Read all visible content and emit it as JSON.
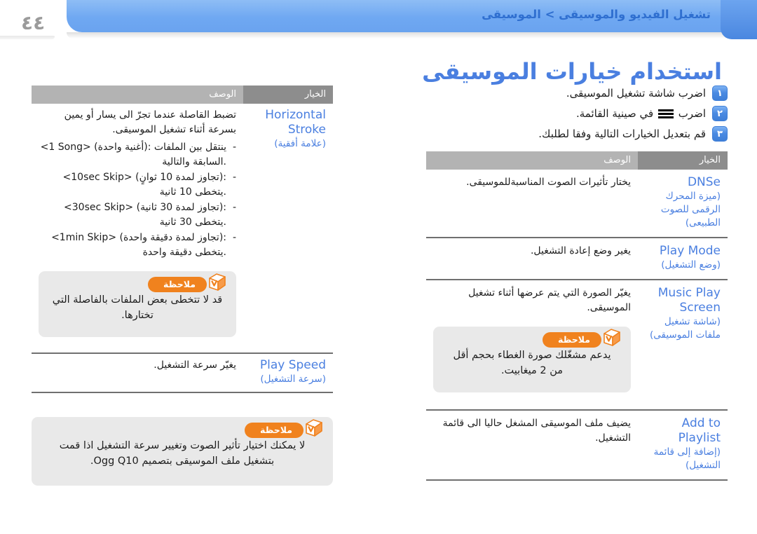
{
  "header": {
    "page_number": "٤٤",
    "breadcrumb": "تشغيل الفيديو والموسيقى > الموسيقى",
    "title": "استخدام خيارات الموسيقى"
  },
  "steps": [
    {
      "num": "١",
      "text": "اضرب شاشة تشغيل الموسيقى."
    },
    {
      "num": "٢",
      "text_before": "اضرب",
      "icon": "hamburger-menu-icon",
      "text_after": "في صينية القائمة."
    },
    {
      "num": "٣",
      "text": "قم بتعديل الخيارات التالية وفقا لطلبك."
    }
  ],
  "table_headers": {
    "option": "الخيار",
    "description": "الوصف"
  },
  "right_table": {
    "rows": [
      {
        "option_en": "DNSe",
        "option_ar": "(ميزة المحرك الرقمى للصوت الطبيعى)",
        "description": "يختار تأثيرات الصوت المناسبةللموسيقى."
      },
      {
        "option_en": "Play Mode",
        "option_ar": "(وضع التشغيل)",
        "description": "يغير وضع إعادة التشغيل."
      },
      {
        "option_en": "Music Play Screen",
        "option_ar": "(شاشة تشغيل ملفات الموسيقى)",
        "description": "يغيّر الصورة التي يتم عرضها أثناء تشغيل الموسيقى."
      },
      {
        "option_en": "Add to Playlist",
        "option_ar": "(إضافة إلى قائمة التشغيل)",
        "description": "يضيف ملف الموسيقى المشغل حاليا الى قائمة التشغيل."
      }
    ],
    "note": {
      "label": "ملاحظة",
      "text": "يدعم مشغّلك صورة الغطاء بحجم أقل من 2 ميغابيت."
    }
  },
  "left_table": {
    "rows": [
      {
        "option_en": "Horizontal Stroke",
        "option_ar": "(علامة أفقية)",
        "description_lead": "تضبط القاصلة عندما تجرّ الى يسار أو يمين بسرعة أثناء تشغيل الموسيقى.",
        "bullets": [
          "<1 Song> (أغنية واحدة): ينتقل بين الملفات السابقة والتالية.",
          "<10sec Skip> (تجاوز لمدة 10 ثوانٍ): يتخطى 10 ثانية.",
          "<30sec Skip> (تجاوز لمدة 30 ثانية): يتخطى 30 ثانية.",
          "<1min Skip> (تجاوز لمدة دقيقة واحدة): يتخطى دقيقة واحدة."
        ]
      },
      {
        "option_en": "Play Speed",
        "option_ar": "(سرعة التشغيل)",
        "description_lead": "يغيّر سرعة التشغيل.",
        "bullets": []
      }
    ],
    "note_mid": {
      "label": "ملاحظة",
      "text": "قد لا تتخطى بعض الملفات بالفاصلة التي تختارها."
    },
    "note_bottom": {
      "label": "ملاحظة",
      "text": "لا يمكنك اختيار تأثير الصوت وتغيير سرعة التشغيل اذا قمت بتشغيل ملف الموسيقى بتصميم Ogg Q10."
    }
  },
  "colors": {
    "accent_blue": "#4a7fe0",
    "banner_blue": "#6fa8f2",
    "note_orange": "#f0821e",
    "header_dark_gray": "#8d8d8d",
    "header_light_gray": "#b3b3b3",
    "note_bg": "#e9e9e9"
  }
}
